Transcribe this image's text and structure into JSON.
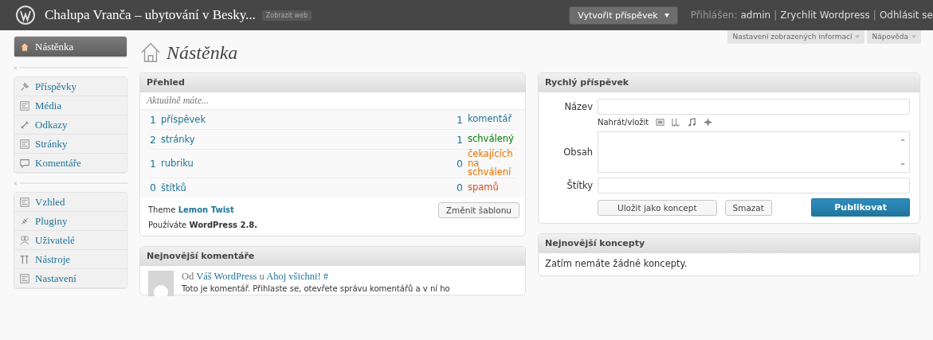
{
  "header": {
    "site_title": "Chalupa Vranča – ubytování v Besky...",
    "view_site": "Zobrazit web",
    "new_post_button": "Vytvořit příspěvek",
    "greeting": "Přihlášen:",
    "separator": "|",
    "links": [
      "admin",
      "Zrychlit Wordpress",
      "Odhlásit se"
    ]
  },
  "screen_tabs": [
    "Nastavení zobrazených informací",
    "Nápověda"
  ],
  "sidebar": {
    "groups": [
      [
        {
          "label": "Nástěnka",
          "selected": true
        }
      ],
      [
        {
          "label": "Příspěvky",
          "selected": false
        },
        {
          "label": "Média",
          "selected": false
        },
        {
          "label": "Odkazy",
          "selected": false
        },
        {
          "label": "Stránky",
          "selected": false
        },
        {
          "label": "Komentáře",
          "selected": false
        }
      ],
      [
        {
          "label": "Vzhled",
          "selected": false
        },
        {
          "label": "Pluginy",
          "selected": false
        },
        {
          "label": "Uživatelé",
          "selected": false
        },
        {
          "label": "Nástroje",
          "selected": false
        },
        {
          "label": "Nastavení",
          "selected": false
        }
      ]
    ],
    "collapse": "«"
  },
  "page_title": "Nástěnka",
  "overview": {
    "title": "Přehled",
    "subtitle": "Aktuálně máte...",
    "rows": [
      {
        "left": {
          "count": "1",
          "label": "příspěvek"
        },
        "right": {
          "count": "1",
          "label": "komentář",
          "color": "#21759b"
        }
      },
      {
        "left": {
          "count": "2",
          "label": "stránky"
        },
        "right": {
          "count": "1",
          "label": "schválený",
          "color": "#008000"
        }
      },
      {
        "left": {
          "count": "1",
          "label": "rubriku"
        },
        "right": {
          "count": "0",
          "label": "čekajících na schválení",
          "color": "#e66f00"
        }
      },
      {
        "left": {
          "count": "0",
          "label": "štítků"
        },
        "right": {
          "count": "0",
          "label": "spamů",
          "color": "#d54e21"
        }
      }
    ],
    "theme_label": "Theme",
    "theme_name": "Lemon Twist",
    "change_theme": "Změnit šablonu",
    "version": "Používáte **WordPress 2.8.**"
  },
  "recent_comments": {
    "title": "Nejnovější komentáře",
    "comment": {
      "prefix": "Od",
      "author": "Váš WordPress",
      "joiner": "u",
      "post": "Ahoj všichni!",
      "hash": "#",
      "excerpt": "Toto je komentář. Přihlaste se, otevřete správu komentářů a v ní ho"
    }
  },
  "quick_post": {
    "title": "Rychlý příspěvek",
    "title_label": "Název",
    "upload_label": "Nahrát/vložit",
    "content_label": "Obsah",
    "tags_label": "Štítky",
    "save_draft": "Uložit jako koncept",
    "reset": "Smazat",
    "publish": "Publikovat"
  },
  "drafts": {
    "title": "Nejnovější koncepty",
    "message": "Zatím nemáte žádné koncepty."
  }
}
